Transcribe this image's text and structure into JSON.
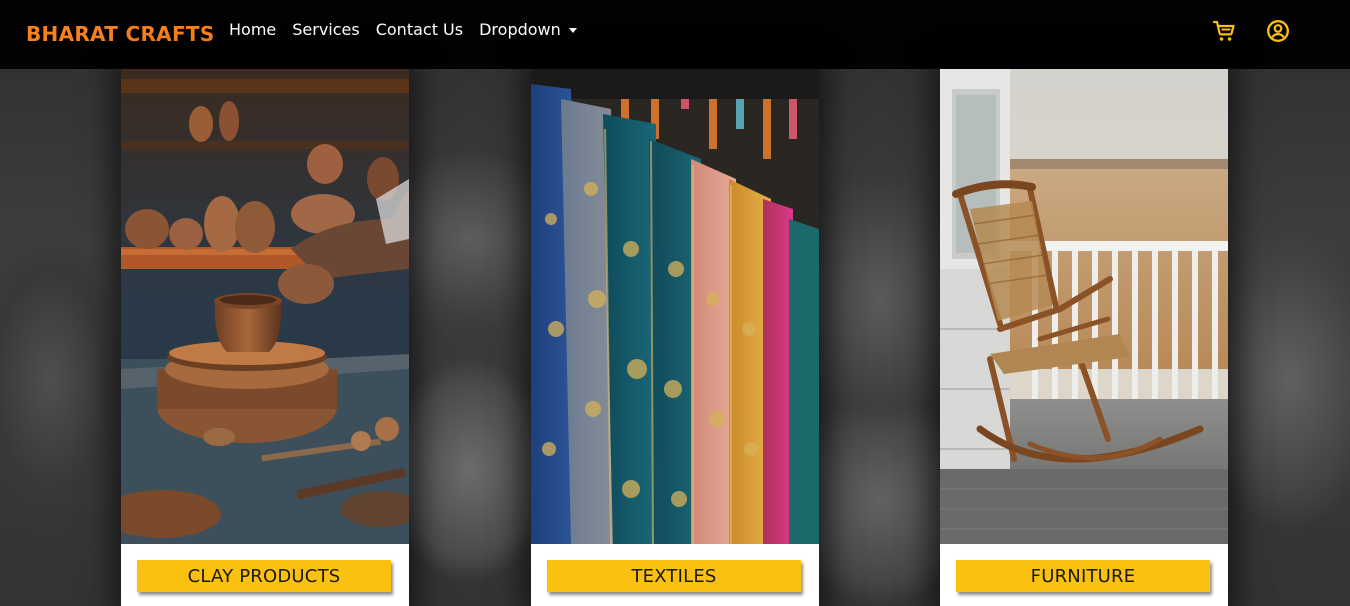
{
  "brand": {
    "name": "BHARAT CRAFTS",
    "color": "#f7811e"
  },
  "nav": {
    "items": [
      {
        "label": "Home"
      },
      {
        "label": "Services"
      },
      {
        "label": "Contact Us"
      },
      {
        "label": "Dropdown"
      }
    ],
    "icons": [
      "cart-icon",
      "user-circle-icon"
    ],
    "icon_color": "#fbc110"
  },
  "cards": [
    {
      "title": "CLAY PRODUCTS",
      "image": "potter-wheel-clay-pot"
    },
    {
      "title": "TEXTILES",
      "image": "hanging-silk-sarees"
    },
    {
      "title": "FURNITURE",
      "image": "wooden-rocking-chair-porch"
    }
  ],
  "colors": {
    "accent": "#fbc110",
    "navbar": "#020202",
    "card_bg": "#ffffff"
  }
}
